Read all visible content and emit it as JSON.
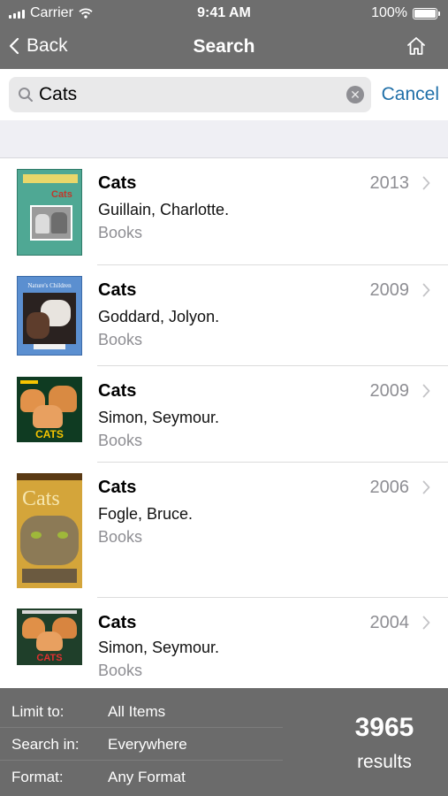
{
  "status_bar": {
    "carrier": "Carrier",
    "time": "9:41 AM",
    "battery": "100%",
    "battery_level": 1.0
  },
  "nav": {
    "back_label": "Back",
    "title": "Search"
  },
  "search": {
    "value": "Cats",
    "cancel_label": "Cancel"
  },
  "results": [
    {
      "title": "Cats",
      "author": "Guillain, Charlotte.",
      "format": "Books",
      "year": "2013",
      "cover_text": "Cats"
    },
    {
      "title": "Cats",
      "author": "Goddard, Jolyon.",
      "format": "Books",
      "year": "2009",
      "cover_text": "Nature's Children"
    },
    {
      "title": "Cats",
      "author": "Simon, Seymour.",
      "format": "Books",
      "year": "2009",
      "cover_text": "CATS"
    },
    {
      "title": "Cats",
      "author": "Fogle, Bruce.",
      "format": "Books",
      "year": "2006",
      "cover_text": "Cats"
    },
    {
      "title": "Cats",
      "author": "Simon, Seymour.",
      "format": "Books",
      "year": "2004",
      "cover_text": "CATS"
    }
  ],
  "footer": {
    "filters": [
      {
        "label": "Limit to:",
        "value": "All Items"
      },
      {
        "label": "Search in:",
        "value": "Everywhere"
      },
      {
        "label": "Format:",
        "value": "Any Format"
      }
    ],
    "count": "3965",
    "count_label": "results"
  },
  "colors": {
    "bar": "#6e6e6e",
    "link": "#1f6fa8",
    "muted": "#8e8e93"
  },
  "icons": {
    "back": "chevron-left-icon",
    "home": "home-icon",
    "search": "search-icon",
    "clear": "clear-icon",
    "row": "chevron-right-icon"
  }
}
